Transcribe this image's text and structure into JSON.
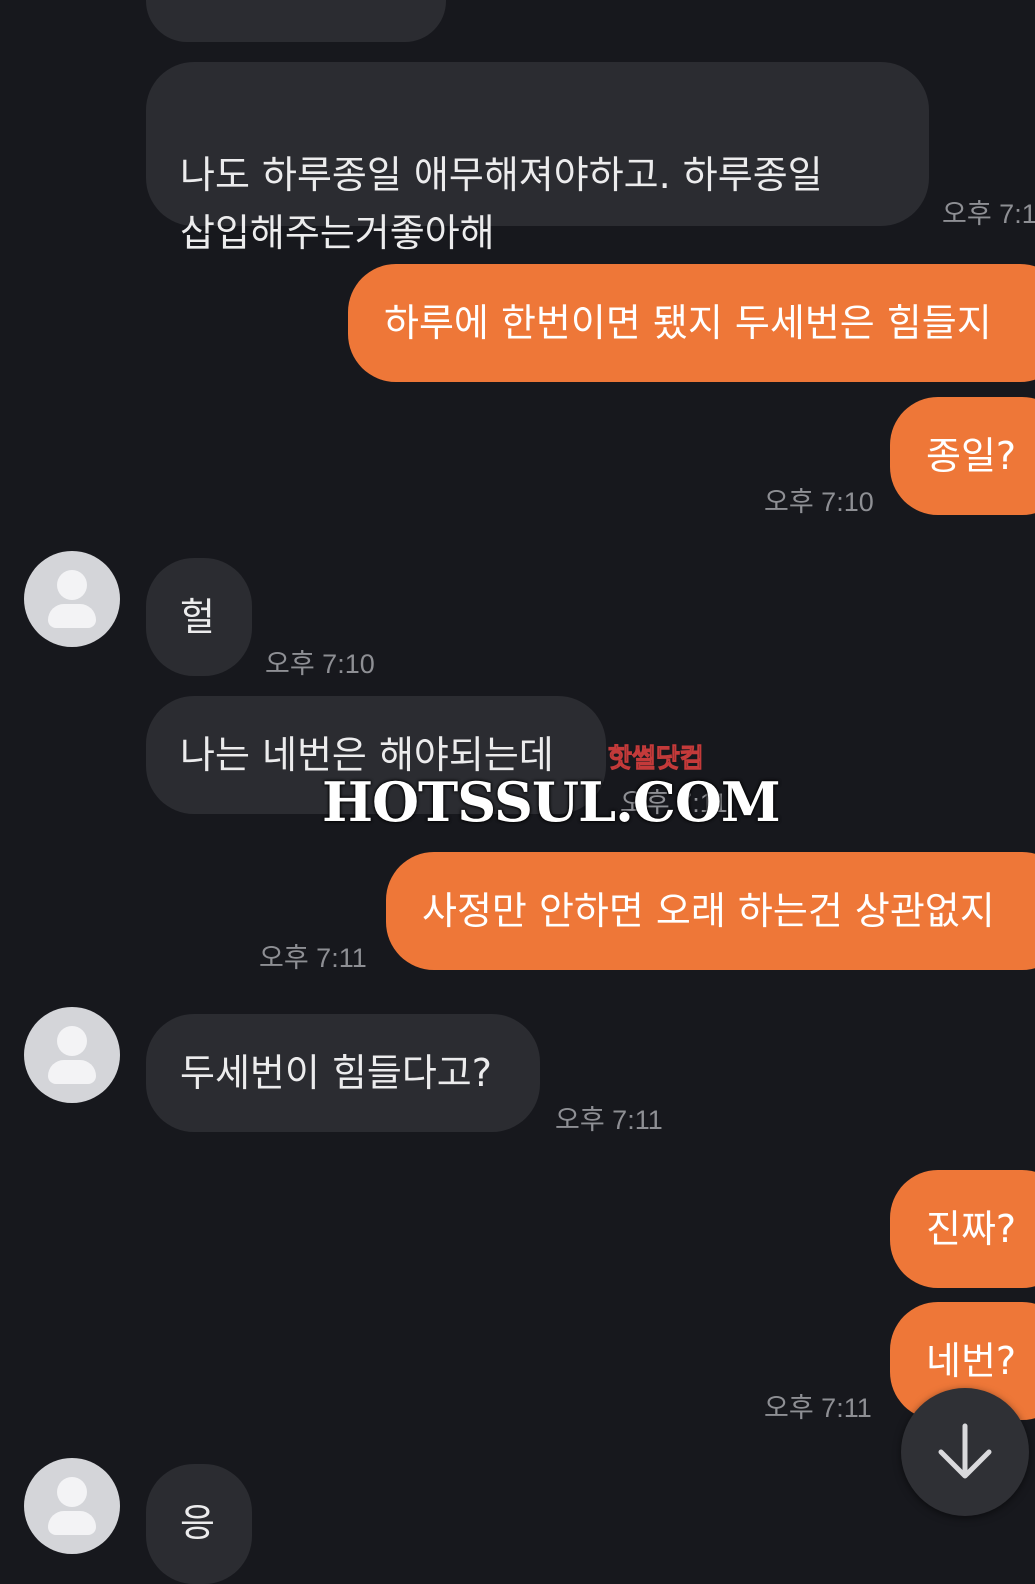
{
  "messages": [
    {
      "side": "in",
      "text": ""
    },
    {
      "side": "in",
      "text": "나도 하루종일 애무해져야하고. 하루종일\n삽입해주는거좋아해",
      "time": "오후 7:1"
    },
    {
      "side": "out",
      "text": "하루에 한번이면 됐지 두세번은 힘들지"
    },
    {
      "side": "out",
      "text": "종일?",
      "time": "오후 7:10"
    },
    {
      "side": "in",
      "text": "헐",
      "time": "오후 7:10"
    },
    {
      "side": "in",
      "text": "나는 네번은 해야되는데",
      "time": "오후 7:11"
    },
    {
      "side": "out",
      "text": "사정만 안하면 오래 하는건 상관없지",
      "time": "오후 7:11"
    },
    {
      "side": "in",
      "text": "두세번이 힘들다고?",
      "time": "오후 7:11"
    },
    {
      "side": "out",
      "text": "진짜?"
    },
    {
      "side": "out",
      "text": "네번?",
      "time": "오후 7:11"
    },
    {
      "side": "in",
      "text": "응"
    }
  ],
  "watermark": {
    "small": "핫썰닷컴",
    "big": "HOTSSUL.COM"
  },
  "icons": {
    "scroll_down": "arrow-down-icon",
    "avatar": "default-avatar-icon"
  },
  "colors": {
    "background": "#17181d",
    "incoming": "#2b2c31",
    "outgoing": "#ee7738",
    "time": "#8e8f94"
  }
}
